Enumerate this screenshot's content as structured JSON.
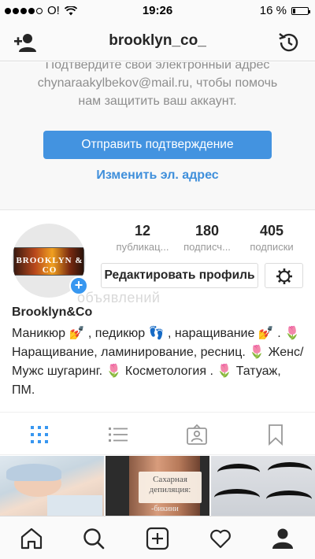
{
  "status_bar": {
    "carrier": "O!",
    "time": "19:26",
    "battery_text": "16 %",
    "battery_level": 0.16,
    "signal_bars_filled": 4,
    "signal_bars_total": 5
  },
  "header": {
    "title": "brooklyn_co_",
    "left_icon": "add-person-icon",
    "right_icon": "history-icon"
  },
  "banner": {
    "message": "Подтвердите свой электронный адрес chynaraakylbekov@mail.ru, чтобы помочь нам защитить ваш аккаунт.",
    "confirm_label": "Отправить подтверждение",
    "change_label": "Изменить эл. адрес"
  },
  "profile": {
    "avatar_text": "BROOKLYN & CO",
    "stats": [
      {
        "value": "12",
        "label": "публикац..."
      },
      {
        "value": "180",
        "label": "подписч..."
      },
      {
        "value": "405",
        "label": "подписки"
      }
    ],
    "edit_label": "Редактировать профиль",
    "watermark": "объявлений",
    "name": "Brooklyn&Co",
    "bio": "Маникюр 💅 , педикюр 👣 , наращивание 💅 . 🌷 Наращивание, ламинирование, ресниц. 🌷 Женс/Мужс шугаринг. 🌷 Косметология . 🌷 Татуаж, ПМ."
  },
  "tabs": [
    "grid-icon",
    "list-icon",
    "tagged-icon",
    "saved-icon"
  ],
  "grid": {
    "thumb2_card_text": "Сахарная депиляция:",
    "thumb2_under_text": "-бикини"
  },
  "nav": [
    "home-icon",
    "search-icon",
    "new-post-icon",
    "activity-icon",
    "profile-icon"
  ],
  "colors": {
    "accent": "#3897f0",
    "button_blue": "#4393e0",
    "link_blue": "#3f8fdb",
    "text": "#262626",
    "muted": "#8e8e8e"
  }
}
